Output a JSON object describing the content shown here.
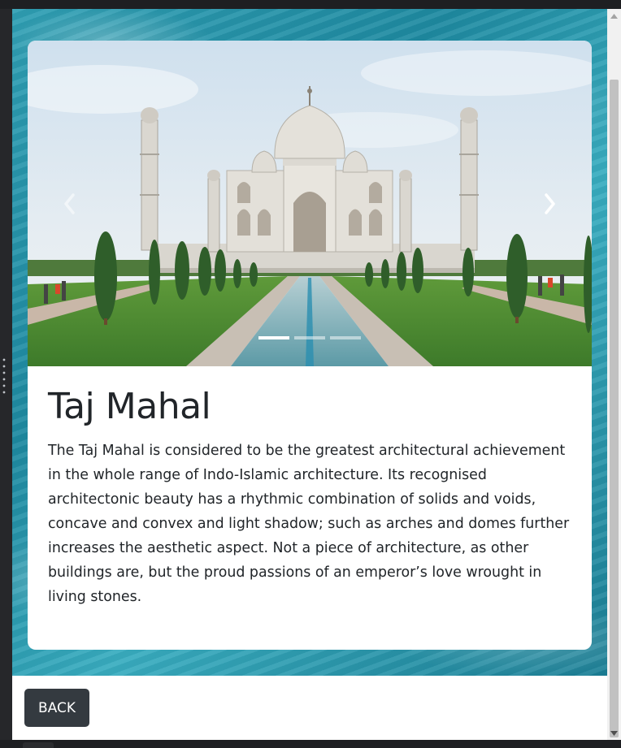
{
  "carousel": {
    "prev_label": "Previous",
    "next_label": "Next",
    "image_alt": "Taj Mahal with reflecting pool and gardens",
    "indicators": [
      "slide-1",
      "slide-2",
      "slide-3"
    ],
    "active_index": 0
  },
  "card": {
    "title": "Taj Mahal",
    "text": "The Taj Mahal is considered to be the greatest architectural achievement in the whole range of Indo-Islamic architecture. Its recognised architectonic beauty has a rhythmic combination of solids and voids, concave and convex and light shadow; such as arches and domes further increases the aesthetic aspect. Not a piece of architecture, as other buildings are, but the proud passions of an emperor’s love wrought in living stones."
  },
  "footer": {
    "back_label": "BACK"
  },
  "colors": {
    "water": "#2f9fb4",
    "button": "#343a40",
    "text": "#212529"
  }
}
